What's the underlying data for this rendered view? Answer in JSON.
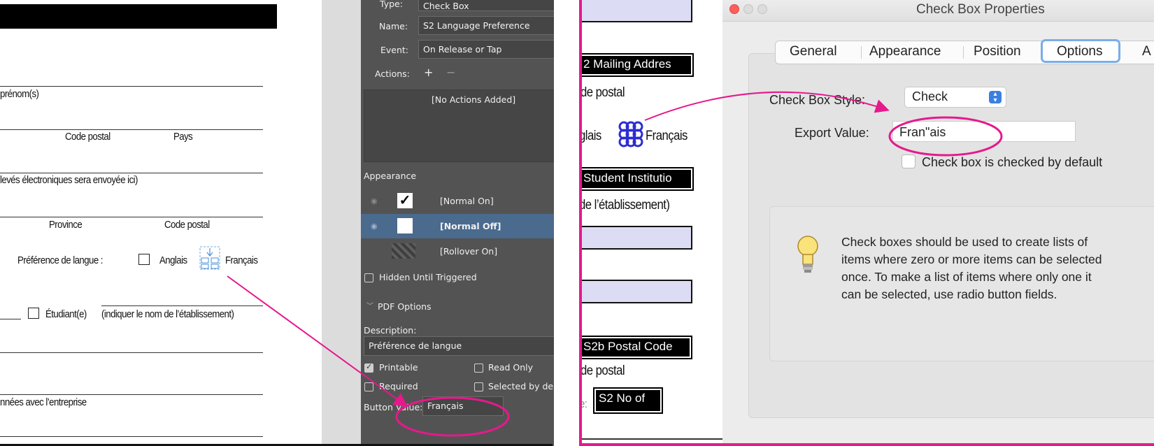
{
  "left_form": {
    "labels": {
      "prenom": "prénom(s)",
      "code_postal": "Code postal",
      "pays": "Pays",
      "releves": "levés électroniques sera envoyée ici)",
      "province": "Province",
      "code_postal_2": "Code postal",
      "pref_langue": "Préférence de langue :",
      "anglais": "Anglais",
      "francais": "Français",
      "etudiant": "Étudiant(e)",
      "etablissement": "(indiquer le nom de l’établissement)",
      "annees": "nnées avec l’entreprise"
    }
  },
  "indesign": {
    "type_label": "Type:",
    "type_value": "Check Box",
    "name_label": "Name:",
    "name_value": "S2 Language Preference",
    "event_label": "Event:",
    "event_value": "On Release or Tap",
    "actions_label": "Actions:",
    "add_action": "+",
    "remove_action": "−",
    "no_actions": "[No Actions Added]",
    "appearance_title": "Appearance",
    "appearance_states": [
      {
        "label": "[Normal On]"
      },
      {
        "label": "[Normal Off]"
      },
      {
        "label": "[Rollover On]"
      }
    ],
    "hidden_until_triggered": "Hidden Until Triggered",
    "pdf_options": "PDF Options",
    "description_label": "Description:",
    "description_value": "Préférence de langue",
    "printable": "Printable",
    "read_only": "Read Only",
    "required": "Required",
    "selected_by_default": "Selected by de",
    "button_value_label": "Button Value:",
    "button_value": "Français",
    "colors": {
      "panel_dark": "#535353",
      "selected_row": "#4a6a8e",
      "highlight": "#e6198c"
    }
  },
  "pdf_strip": {
    "mailing_address": "2 Mailing Addres",
    "de_postal": "de postal",
    "glais": "glais",
    "francais": "Français",
    "student_institution": "Student Institutio",
    "de_etablissement": "de l’établissement)",
    "postal_code_2b": "S2b Postal Code",
    "de_postal_2": "de postal",
    "no_of": "S2 No of",
    "e_colon": "e:"
  },
  "dialog": {
    "title": "Check Box Properties",
    "tabs": [
      "General",
      "Appearance",
      "Position",
      "Options",
      "A"
    ],
    "active_tab": "Options",
    "style_label": "Check Box Style:",
    "style_value": "Check",
    "export_label": "Export Value:",
    "export_value": "Fran\"ais",
    "default_checkbox": "Check box is checked by default",
    "info_text": [
      "Check boxes should be used to create lists of",
      "items where zero or more items can be selected",
      "once. To make a list of items where only one it",
      "can be selected, use radio button fields."
    ]
  }
}
